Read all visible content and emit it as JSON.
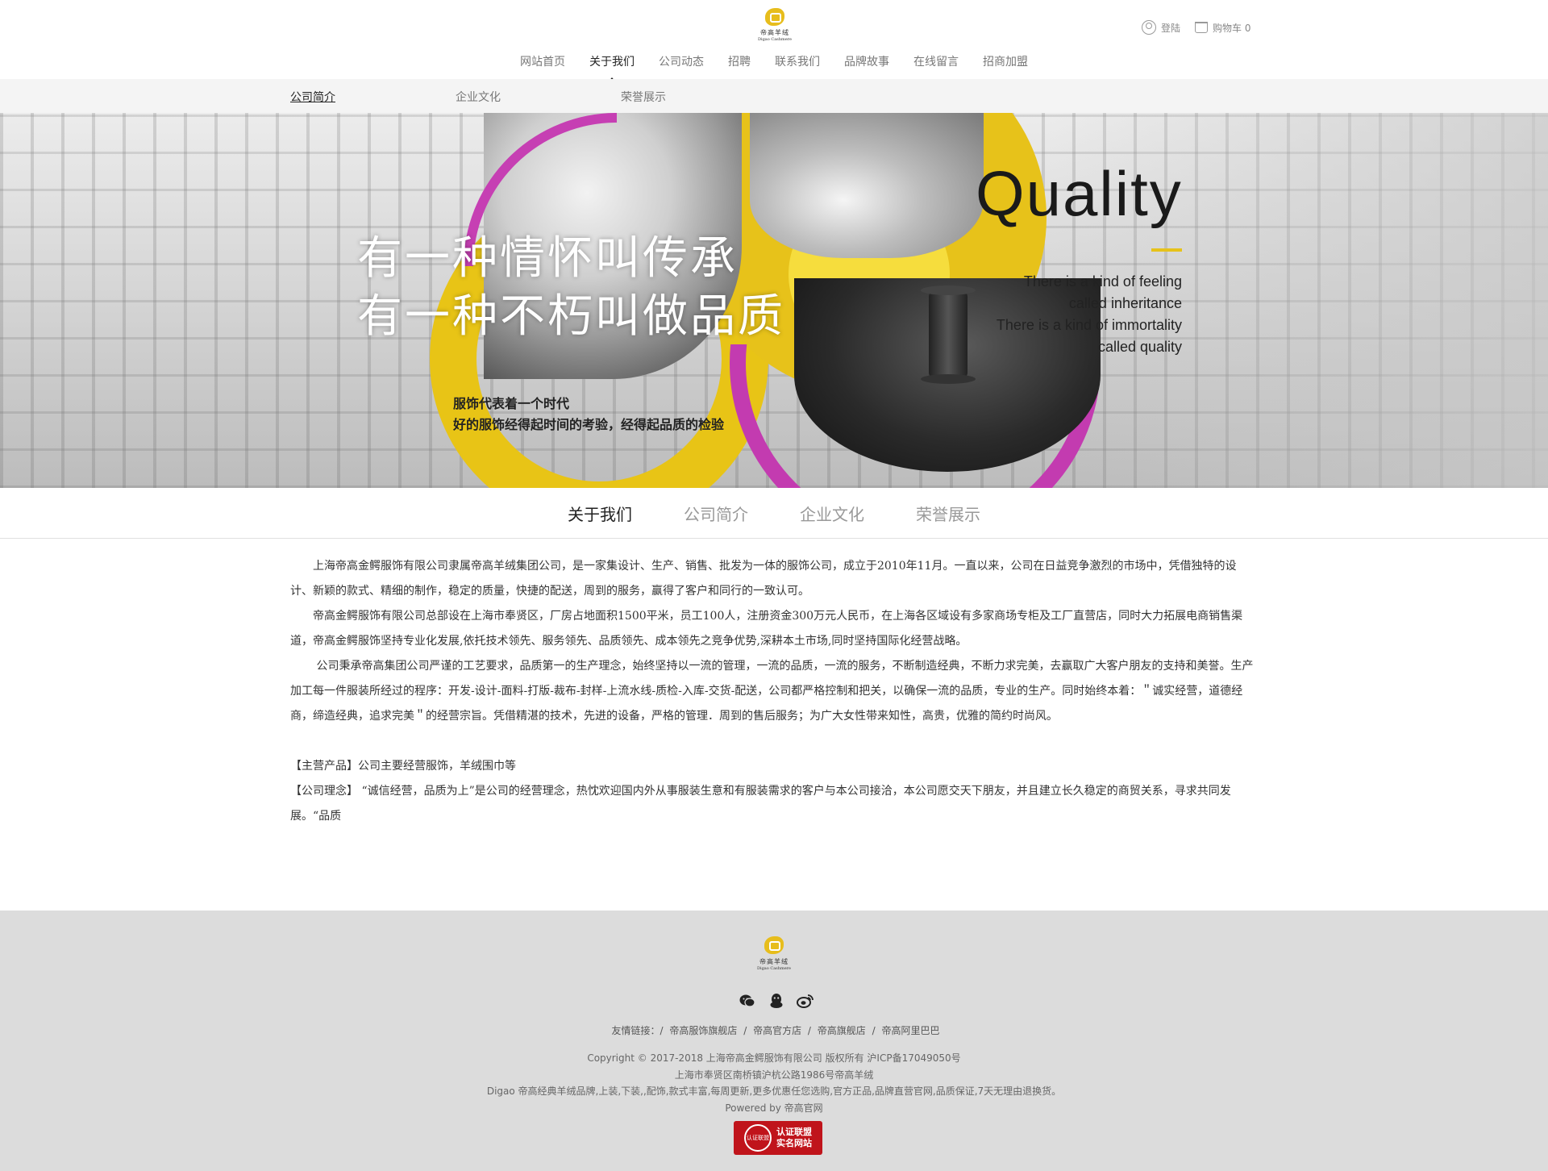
{
  "brand": {
    "logo_cn": "帝高羊绒",
    "logo_en": "Digao Cashmere"
  },
  "header": {
    "login": "登陆",
    "cart": "购物车 0"
  },
  "nav": {
    "items": [
      "网站首页",
      "关于我们",
      "公司动态",
      "招聘",
      "联系我们",
      "品牌故事",
      "在线留言",
      "招商加盟"
    ]
  },
  "subnav": {
    "items": [
      "公司简介",
      "企业文化",
      "荣誉展示"
    ]
  },
  "banner": {
    "slogan_1": "有一种情怀叫传承",
    "slogan_2": "有一种不朽叫做品质",
    "tagline_1": "服饰代表着一个时代",
    "tagline_2": "好的服饰经得起时间的考验，经得起品质的检验",
    "quality": "Quality",
    "q_line1": "There is a kind of feeling",
    "q_line2a": "called ",
    "q_line2b": "inheritance",
    "q_line3": "There is a kind of immortality",
    "q_line4a": "called ",
    "q_line4b": "quality"
  },
  "tabs": {
    "items": [
      "关于我们",
      "公司简介",
      "企业文化",
      "荣誉展示"
    ]
  },
  "content": {
    "p1": "　　上海帝高金鳄服饰有限公司隶属帝高羊绒集团公司，是一家集设计、生产、销售、批发为一体的服饰公司，成立于2010年11月。一直以来，公司在日益竞争激烈的市场中，凭借独特的设计、新颖的款式、精细的制作，稳定的质量，快捷的配送，周到的服务，赢得了客户和同行的一致认可。",
    "p2": "　　帝高金鳄服饰有限公司总部设在上海市奉贤区，厂房占地面积1500平米，员工100人，注册资金300万元人民币，在上海各区域设有多家商场专柜及工厂直营店，同时大力拓展电商销售渠道，帝高金鳄服饰坚持专业化发展,依托技术领先、服务领先、品质领先、成本领先之竞争优势,深耕本土市场,同时坚持国际化经营战略。",
    "p3": "　　 公司秉承帝高集团公司严谨的工艺要求，品质第一的生产理念，始终坚持以一流的管理，一流的品质，一流的服务，不断制造经典，不断力求完美，去赢取广大客户朋友的支持和美誉。生产加工每一件服装所经过的程序：开发-设计-面料-打版-裁布-封样-上流水线-质检-入库-交货-配送，公司都严格控制和把关，以确保一流的品质，专业的生产。同时始终本着：＂诚实经营，道德经商，缔造经典，追求完美＂的经营宗旨。凭借精湛的技术，先进的设备，严格的管理．周到的售后服务；为广大女性带来知性，高贵，优雅的简约时尚风。",
    "p4": "【主营产品】公司主要经营服饰，羊绒围巾等",
    "p5": "【公司理念】 “诚信经营，品质为上”是公司的经营理念，热忱欢迎国内外从事服装生意和有服装需求的客户与本公司接洽，本公司愿交天下朋友，并且建立长久稳定的商贸关系，寻求共同发展。“品质"
  },
  "footer": {
    "links_label": "友情链接：/",
    "links": [
      "帝高服饰旗舰店",
      "帝高官方店",
      "帝高旗舰店",
      "帝高阿里巴巴"
    ],
    "copyright": "Copyright © 2017-2018 上海帝高金鳄服饰有限公司 版权所有 沪ICP备17049050号",
    "address": "上海市奉贤区南桥镇沪杭公路1986号帝高羊绒",
    "desc": "Digao 帝高经典羊绒品牌,上装,下装,,配饰,款式丰富,每周更新,更多优惠任您选购,官方正品,品牌直营官网,品质保证,7天无理由退换货。",
    "powered": "Powered by 帝高官网",
    "badge_seal": "认证联盟",
    "badge_line1": "认证联盟",
    "badge_line2": "实名网站"
  },
  "icons": {
    "social": [
      "wechat-icon",
      "qq-icon",
      "weibo-icon"
    ]
  },
  "colors": {
    "accent_yellow": "#e7c21a",
    "accent_magenta": "#c33bb0",
    "footer_bg": "#dcdcdc",
    "badge_red": "#c0141b"
  }
}
